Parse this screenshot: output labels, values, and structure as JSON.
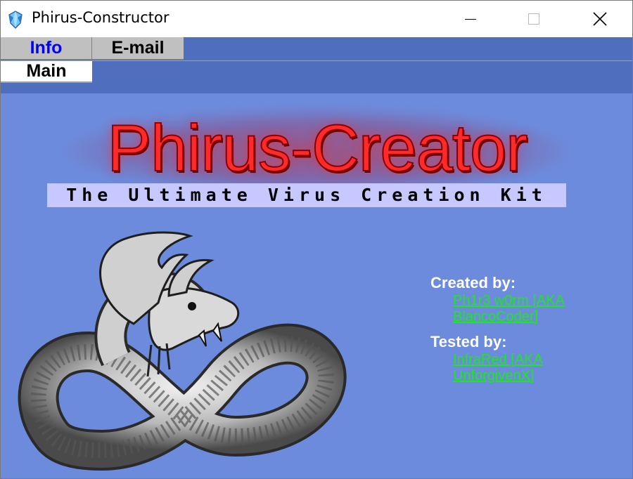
{
  "window": {
    "title": "Phirus-Constructor",
    "icon": "crystal-app-icon",
    "controls": [
      "minimize-icon",
      "maximize-icon",
      "close-icon"
    ]
  },
  "tabs": {
    "row1": [
      {
        "label": "Info",
        "active": true
      },
      {
        "label": "E-mail",
        "active": false
      }
    ],
    "row2": [
      {
        "label": "Main",
        "active": true
      }
    ]
  },
  "logo": {
    "title": "Phirus-Creator",
    "tagline": "The Ultimate Virus Creation Kit",
    "graphic": "serpent-illustration"
  },
  "credits": {
    "created_label": "Created by:",
    "created_link": "Ph1r3 w0rm [AKA BlancoCoder]",
    "tested_label": "Tested by:",
    "tested_link": "InfraRed [AKA UnforgivenX]"
  },
  "colors": {
    "background": "#6d8bdc",
    "tabstrip": "#4f6fbe",
    "logo_red": "#ff2a2a",
    "tagline_bg": "#c7c8ff",
    "link_green": "#1ce81c",
    "active_tab_text": "#0000ff"
  }
}
